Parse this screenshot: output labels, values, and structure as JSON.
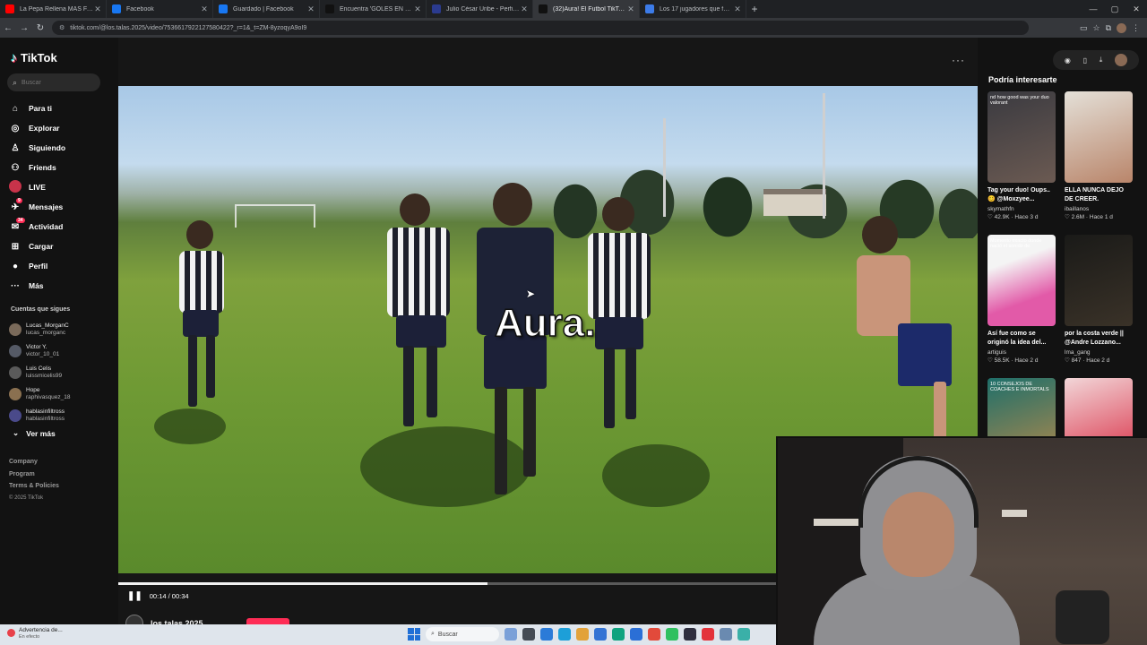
{
  "browser": {
    "tabs": [
      {
        "title": "La Pepa Rellena MÁS FAMOSA",
        "fav": "#ff0000",
        "active": false
      },
      {
        "title": "Facebook",
        "fav": "#1877f2",
        "active": false
      },
      {
        "title": "Guardado | Facebook",
        "fav": "#1877f2",
        "active": false
      },
      {
        "title": "Encuentra 'GOLES EN TIKTOK'",
        "fav": "#111111",
        "active": false
      },
      {
        "title": "Julio César Uribe - Perfil del jug...",
        "fav": "#2b3b8f",
        "active": false
      },
      {
        "title": "(32)Aura! El Futbol TikTok d...",
        "fav": "#111111",
        "active": true
      },
      {
        "title": "Los 17 jugadores que fueron b...",
        "fav": "#3c7be8",
        "active": false
      }
    ],
    "url": "tiktok.com/@los.talas.2025/video/7536617922127580422?_r=1&_t=ZM-8yzoqyA9oI9"
  },
  "sidebar": {
    "logo": "TikTok",
    "search_placeholder": "Buscar",
    "menu": [
      {
        "label": "Para ti",
        "icon": "home-icon",
        "glyph": "⌂"
      },
      {
        "label": "Explorar",
        "icon": "compass-icon",
        "glyph": "◎"
      },
      {
        "label": "Siguiendo",
        "icon": "following-icon",
        "glyph": "♙"
      },
      {
        "label": "Friends",
        "icon": "friends-icon",
        "glyph": "⚇"
      },
      {
        "label": "LIVE",
        "icon": "live-icon",
        "glyph": ""
      },
      {
        "label": "Mensajes",
        "icon": "messages-icon",
        "glyph": "✈",
        "badge": "9"
      },
      {
        "label": "Actividad",
        "icon": "activity-icon",
        "glyph": "✉",
        "badge": "34"
      },
      {
        "label": "Cargar",
        "icon": "upload-icon",
        "glyph": "⊞"
      },
      {
        "label": "Perfil",
        "icon": "profile-icon",
        "glyph": "●"
      },
      {
        "label": "Más",
        "icon": "more-icon",
        "glyph": "···"
      }
    ],
    "following_heading": "Cuentas que sigues",
    "following": [
      {
        "name": "Lucas_MorganC",
        "handle": "lucas_morganc",
        "color": "#7a6a5a"
      },
      {
        "name": "Victor Y.",
        "handle": "victor_10_01",
        "color": "#555a66"
      },
      {
        "name": "Luis Celis",
        "handle": "luissmicelis99",
        "color": "#5a5a5a"
      },
      {
        "name": "Hope",
        "handle": "raphivasquez_18",
        "color": "#8a7050"
      },
      {
        "name": "hablasinfiltross",
        "handle": "hablasinfiltross",
        "color": "#4a4a8a"
      }
    ],
    "see_more": "Ver más",
    "footer": [
      "Company",
      "Program",
      "Terms & Policies"
    ],
    "copyright": "© 2025 TikTok"
  },
  "video": {
    "caption": "Aura.",
    "time": "00:14 / 00:34",
    "progress": 0.43,
    "author": "los.talas.2025"
  },
  "right": {
    "heading": "Podría interesarte",
    "recs": [
      {
        "overlay": "nd how good was your duo valorant",
        "caption": "Tag your duo! Oups.. 😊 @Moxzyee...",
        "user": "skymathfn",
        "views": "42.9K",
        "ago": "Hace 3 d",
        "bg": "linear-gradient(160deg,#3a3a40,#6b5a52)"
      },
      {
        "overlay": "",
        "caption": "ELLA NUNCA DEJO DE CREER.",
        "user": "ibaillanos",
        "views": "2.6M",
        "ago": "Hace 1 d",
        "bg": "linear-gradient(160deg,#e4e0d8,#b9856a)"
      },
      {
        "overlay": "Momento exacto donde nació el sonido de:",
        "caption": "Así fue como se originó la idea del...",
        "user": "artiguis",
        "views": "58.5K",
        "ago": "Hace 2 d",
        "bg": "linear-gradient(160deg,#f4f4f4 30%,#e25aa8 70%)"
      },
      {
        "overlay": "",
        "caption": "por la costa verde || @Andre Lozzano...",
        "user": "lma_gang",
        "views": "847",
        "ago": "Hace 2 d",
        "bg": "linear-gradient(160deg,#1a1a18,#3a3228)"
      },
      {
        "overlay": "10 CONSEJOS DE COACHES E INMORTALS",
        "caption": "",
        "user": "",
        "views": "",
        "ago": "",
        "bg": "linear-gradient(160deg,#1e6f6a,#b88a4a)"
      },
      {
        "overlay": "",
        "caption": "",
        "user": "",
        "views": "",
        "ago": "",
        "bg": "linear-gradient(160deg,#f2d6d8,#d8263e)"
      }
    ]
  },
  "taskbar": {
    "warning_title": "Advertencia de...",
    "warning_sub": "En efecto",
    "search_placeholder": "Buscar",
    "apps": [
      "#7aa0d8",
      "#444b55",
      "#2b7bd8",
      "#1d9fd8",
      "#e2a23a",
      "#3474d4",
      "#0fa37f",
      "#2b6fd6",
      "#e24a3b",
      "#30c060",
      "#2f2f3f",
      "#e3323a",
      "#6a8ab0",
      "#3ab0a8"
    ]
  }
}
